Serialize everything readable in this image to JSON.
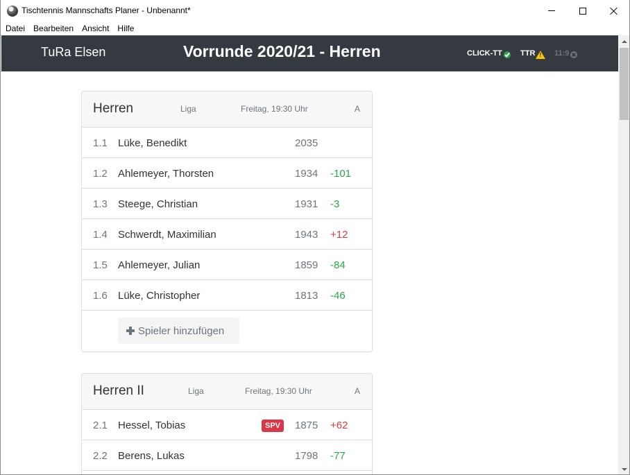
{
  "window": {
    "title": "Tischtennis Mannschafts Planer - Unbenannt*"
  },
  "menu": [
    "Datei",
    "Bearbeiten",
    "Ansicht",
    "Hilfe"
  ],
  "header": {
    "club": "TuRa Elsen",
    "season": "Vorrunde 2020/21 - Herren",
    "status": {
      "click_tt": "CLICK-TT",
      "click_tt_icon": "check-circle-icon",
      "ttr": "TTR",
      "ttr_icon": "warning-icon",
      "time": "11:9",
      "time_icon": "times-circle-icon"
    }
  },
  "teams": [
    {
      "name": "Herren",
      "league": "Liga",
      "schedule": "Freitag, 19:30 Uhr",
      "group": "A",
      "players": [
        {
          "pos": "1.1",
          "name": "Lüke, Benedikt",
          "ttr": "2035",
          "diff": ""
        },
        {
          "pos": "1.2",
          "name": "Ahlemeyer, Thorsten",
          "ttr": "1934",
          "diff": "-101"
        },
        {
          "pos": "1.3",
          "name": "Steege, Christian",
          "ttr": "1931",
          "diff": "-3"
        },
        {
          "pos": "1.4",
          "name": "Schwerdt, Maximilian",
          "ttr": "1943",
          "diff": "+12"
        },
        {
          "pos": "1.5",
          "name": "Ahlemeyer, Julian",
          "ttr": "1859",
          "diff": "-84"
        },
        {
          "pos": "1.6",
          "name": "Lüke, Christopher",
          "ttr": "1813",
          "diff": "-46"
        }
      ],
      "add_player_label": "Spieler hinzufügen"
    },
    {
      "name": "Herren II",
      "league": "Liga",
      "schedule": "Freitag, 19:30 Uhr",
      "group": "A",
      "players": [
        {
          "pos": "2.1",
          "name": "Hessel, Tobias",
          "badge": "SPV",
          "ttr": "1875",
          "diff": "+62"
        },
        {
          "pos": "2.2",
          "name": "Berens, Lukas",
          "ttr": "1798",
          "diff": "-77"
        }
      ]
    }
  ],
  "colors": {
    "header_bg": "#343a40",
    "negative_diff": "#28a745",
    "positive_diff": "#dc3545",
    "badge_bg": "#dc3545"
  }
}
